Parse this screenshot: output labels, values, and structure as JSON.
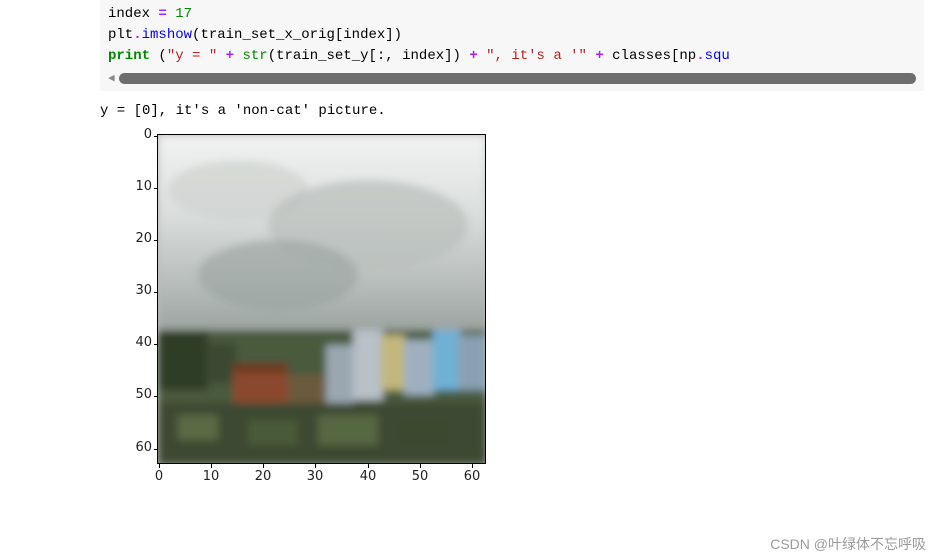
{
  "code": {
    "line1_pre": "index ",
    "line1_op": "=",
    "line1_post": " ",
    "line1_num": "17",
    "line2_a": "plt",
    "line2_dot1": ".",
    "line2_b": "imshow",
    "line2_c": "(train_set_x_orig[index])",
    "line3_a": "print",
    "line3_sp": " (",
    "line3_s1": "\"y = \"",
    "line3_p1": " ",
    "line3_op1": "+",
    "line3_p2": " ",
    "line3_b1": "str",
    "line3_c1": "(train_set_y[:, index]) ",
    "line3_op2": "+",
    "line3_p3": " ",
    "line3_s2": "\", it's a '\"",
    "line3_p4": " ",
    "line3_op3": "+",
    "line3_p5": " classes[np",
    "line3_dot2": ".",
    "line3_c2": "squ"
  },
  "output": {
    "text": "y = [0], it's a 'non-cat' picture."
  },
  "chart_data": {
    "type": "heatmap",
    "title": "",
    "xlabel": "",
    "ylabel": "",
    "ylim": [
      63,
      0
    ],
    "xlim": [
      0,
      63
    ],
    "xticks": [
      "0",
      "10",
      "20",
      "30",
      "40",
      "50",
      "60"
    ],
    "yticks": [
      "0",
      "10",
      "20",
      "30",
      "40",
      "50",
      "60"
    ],
    "description": "64x64 RGB image, cloudy sky over low-rise cityscape"
  },
  "watermark": "CSDN @叶绿体不忘呼吸"
}
